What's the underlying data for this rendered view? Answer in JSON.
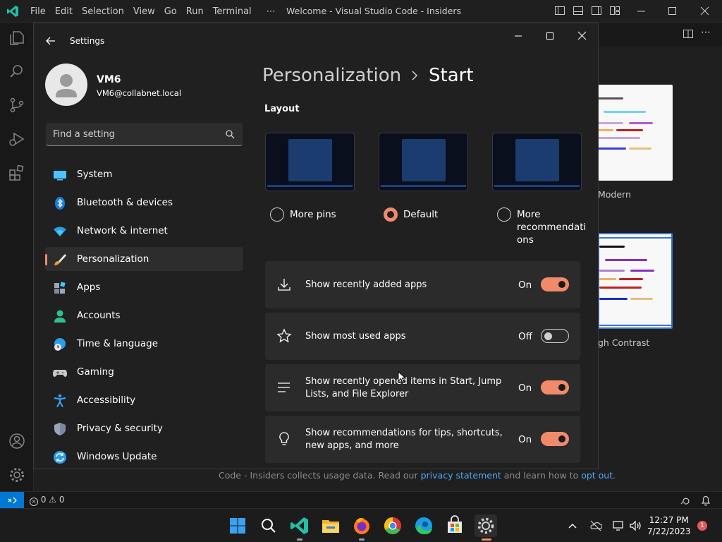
{
  "vscode": {
    "menu": [
      "File",
      "Edit",
      "Selection",
      "View",
      "Go",
      "Run",
      "Terminal",
      "⋯"
    ],
    "window_title": "Welcome - Visual Studio Code - Insiders",
    "themes": [
      {
        "label": "Modern"
      },
      {
        "label": "gh Contrast"
      }
    ],
    "telemetry": {
      "prefix": "Code - Insiders collects usage data. Read our ",
      "privacy_link": "privacy statement",
      "middle": " and learn how to ",
      "opt_out_link": "opt out",
      "suffix": "."
    },
    "status": {
      "errors": "0",
      "warnings": "0"
    }
  },
  "settings": {
    "app_title": "Settings",
    "user": {
      "name": "VM6",
      "email": "VM6@collabnet.local"
    },
    "search_placeholder": "Find a setting",
    "nav": [
      {
        "label": "System",
        "icon": "system-icon",
        "selected": false
      },
      {
        "label": "Bluetooth & devices",
        "icon": "bluetooth-icon",
        "selected": false
      },
      {
        "label": "Network & internet",
        "icon": "wifi-icon",
        "selected": false
      },
      {
        "label": "Personalization",
        "icon": "brush-icon",
        "selected": true
      },
      {
        "label": "Apps",
        "icon": "apps-icon",
        "selected": false
      },
      {
        "label": "Accounts",
        "icon": "accounts-icon",
        "selected": false
      },
      {
        "label": "Time & language",
        "icon": "time-language-icon",
        "selected": false
      },
      {
        "label": "Gaming",
        "icon": "gamepad-icon",
        "selected": false
      },
      {
        "label": "Accessibility",
        "icon": "accessibility-icon",
        "selected": false
      },
      {
        "label": "Privacy & security",
        "icon": "shield-icon",
        "selected": false
      },
      {
        "label": "Windows Update",
        "icon": "update-icon",
        "selected": false
      }
    ],
    "breadcrumb": {
      "parent": "Personalization",
      "current": "Start"
    },
    "layout_heading": "Layout",
    "layout_options": [
      {
        "label": "More pins",
        "selected": false
      },
      {
        "label": "Default",
        "selected": true
      },
      {
        "label": "More recommendations",
        "label_line1": "More",
        "label_line2": "recommendati",
        "label_line3": "ons",
        "selected": false
      }
    ],
    "toggles": [
      {
        "label": "Show recently added apps",
        "label_line1": "Show recently added apps",
        "label_line2": "",
        "state": "On",
        "icon": "download-icon"
      },
      {
        "label": "Show most used apps",
        "label_line1": "Show most used apps",
        "label_line2": "",
        "state": "Off",
        "icon": "star-icon"
      },
      {
        "label": "Show recently opened items in Start, Jump Lists, and File Explorer",
        "label_line1": "Show recently opened items in Start, Jump",
        "label_line2": "Lists, and File Explorer",
        "state": "On",
        "icon": "list-icon"
      },
      {
        "label": "Show recommendations for tips, shortcuts, new apps, and more",
        "label_line1": "Show recommendations for tips, shortcuts,",
        "label_line2": "new apps, and more",
        "state": "On",
        "icon": "lightbulb-icon"
      }
    ],
    "accent_color": "#f08a6b"
  },
  "taskbar": {
    "apps": [
      "start-icon",
      "search-icon",
      "vscode-icon",
      "file-explorer-icon",
      "firefox-icon",
      "chrome-icon",
      "edge-icon",
      "store-icon",
      "settings-icon"
    ],
    "time": "12:27 PM",
    "date": "7/22/2023",
    "notification_count": "1"
  }
}
